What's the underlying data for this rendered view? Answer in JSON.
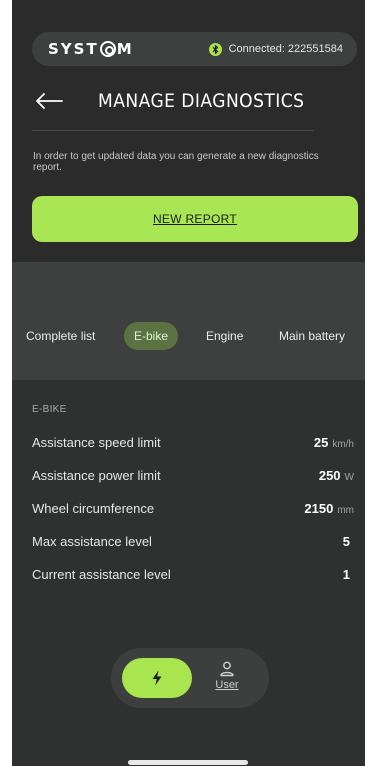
{
  "header": {
    "logo_text_left": "SYST",
    "logo_text_right": "M",
    "connection_status": "Connected: 222551584"
  },
  "page": {
    "title": "MANAGE DIAGNOSTICS",
    "info_text": "In order to get updated data you can generate a new diagnostics report.",
    "new_report_label": "NEW REPORT"
  },
  "tabs": [
    {
      "label": "Complete list",
      "selected": false
    },
    {
      "label": "E-bike",
      "selected": true
    },
    {
      "label": "Engine",
      "selected": false
    },
    {
      "label": "Main battery",
      "selected": false
    }
  ],
  "section": {
    "title": "E-BIKE",
    "rows": [
      {
        "label": "Assistance speed limit",
        "value": "25",
        "unit": "km/h"
      },
      {
        "label": "Assistance power limit",
        "value": "250",
        "unit": "W"
      },
      {
        "label": "Wheel circumference",
        "value": "2150",
        "unit": "mm"
      },
      {
        "label": "Max assistance level",
        "value": "5",
        "unit": ""
      },
      {
        "label": "Current assistance level",
        "value": "1",
        "unit": ""
      }
    ]
  },
  "bottom_nav": {
    "power_icon": "lightning-icon",
    "user_label": "User",
    "user_icon": "user-icon"
  },
  "colors": {
    "accent": "#a9e654",
    "background": "#2f3030",
    "panel": "#3e3f3f",
    "selected_tab": "#5b7342"
  }
}
